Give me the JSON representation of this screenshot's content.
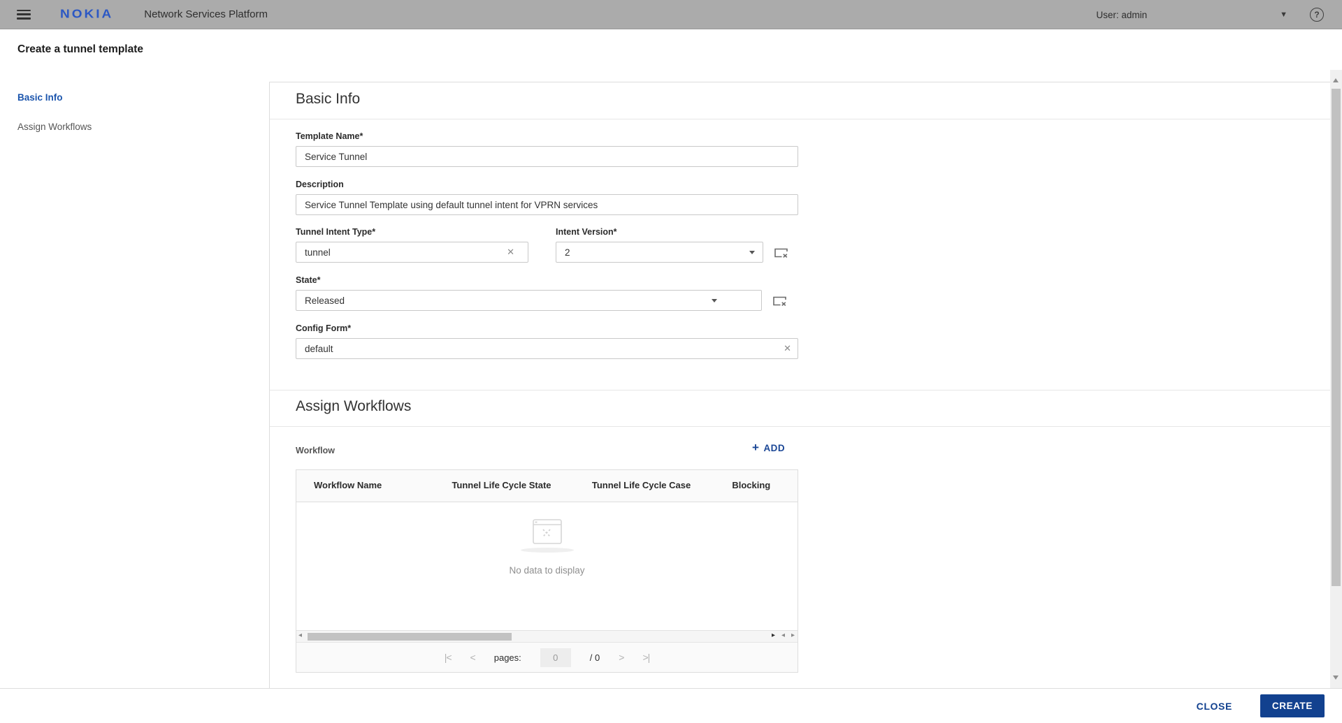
{
  "topbar": {
    "brand": "NOKIA",
    "title": "Network Services Platform",
    "user": "User: admin"
  },
  "page": {
    "title": "Create a tunnel template"
  },
  "sidebar": {
    "items": [
      {
        "label": "Basic Info",
        "active": true
      },
      {
        "label": "Assign Workflows",
        "active": false
      }
    ]
  },
  "basic_info": {
    "heading": "Basic Info",
    "fields": {
      "template_name": {
        "label": "Template Name*",
        "value": "Service Tunnel"
      },
      "description": {
        "label": "Description",
        "value": "Service Tunnel Template using default tunnel intent for VPRN services"
      },
      "tunnel_intent_type": {
        "label": "Tunnel Intent Type*",
        "value": "tunnel"
      },
      "intent_version": {
        "label": "Intent Version*",
        "value": "2"
      },
      "state": {
        "label": "State*",
        "value": "Released"
      },
      "config_form": {
        "label": "Config Form*",
        "value": "default"
      }
    }
  },
  "assign_workflows": {
    "heading": "Assign Workflows",
    "workflow_label": "Workflow",
    "add_label": "ADD",
    "table": {
      "columns": [
        "Workflow Name",
        "Tunnel Life Cycle State",
        "Tunnel Life Cycle Case",
        "Blocking"
      ],
      "rows": [],
      "empty_text": "No data to display"
    },
    "pagination": {
      "first": "|<",
      "prev": "<",
      "label": "pages:",
      "current": "0",
      "total": "/ 0",
      "next": ">",
      "last": ">|"
    }
  },
  "footer": {
    "close": "CLOSE",
    "create": "CREATE"
  },
  "icons": {
    "help": "?",
    "clear": "✕",
    "add_plus": "+",
    "hscroll_left": "◂",
    "hscroll_right": "▸"
  },
  "colors": {
    "brand_blue": "#2c58c4",
    "link_blue": "#1b4796",
    "button_blue": "#12418f",
    "topbar_gray": "#ababab"
  }
}
